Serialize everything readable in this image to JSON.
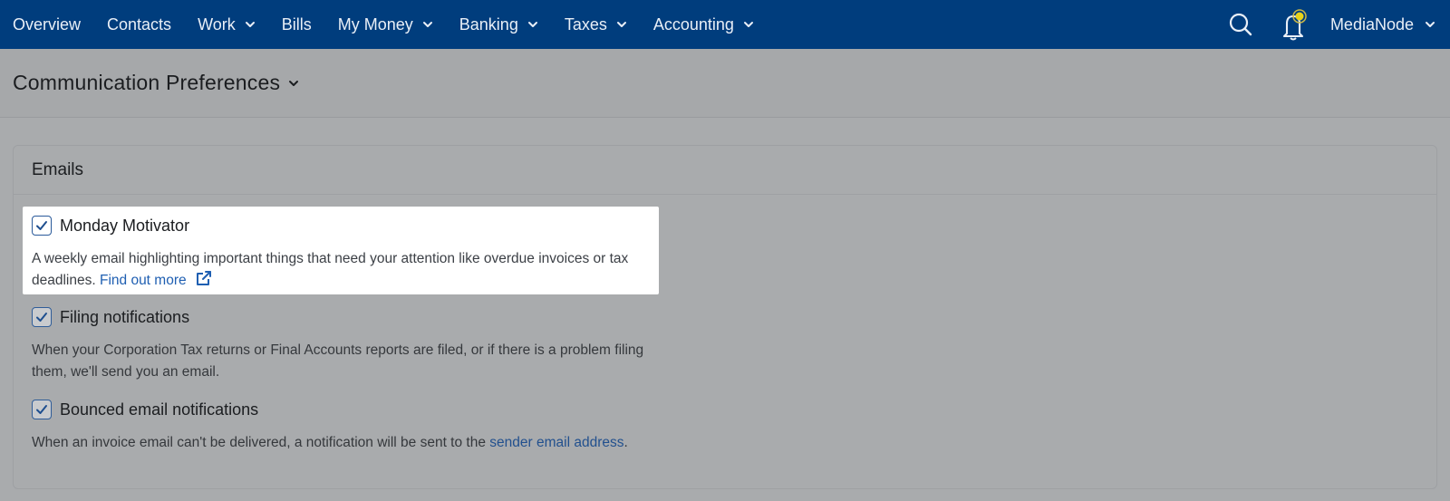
{
  "nav": {
    "items": [
      {
        "label": "Overview",
        "has_dropdown": false
      },
      {
        "label": "Contacts",
        "has_dropdown": false
      },
      {
        "label": "Work",
        "has_dropdown": true
      },
      {
        "label": "Bills",
        "has_dropdown": false
      },
      {
        "label": "My Money",
        "has_dropdown": true
      },
      {
        "label": "Banking",
        "has_dropdown": true
      },
      {
        "label": "Taxes",
        "has_dropdown": true
      },
      {
        "label": "Accounting",
        "has_dropdown": true
      }
    ],
    "account_name": "MediaNode",
    "icons": {
      "search": "search-icon",
      "notifications": "bell-icon"
    },
    "colors": {
      "bar": "#003d7d",
      "notification_dot": "#e8d31a"
    }
  },
  "page": {
    "title": "Communication Preferences"
  },
  "emails": {
    "heading": "Emails",
    "preferences": [
      {
        "label": "Monday Motivator",
        "checked": true,
        "description": "A weekly email highlighting important things that need your attention like overdue invoices or tax deadlines.",
        "link_text": "Find out more",
        "suffix": ""
      },
      {
        "label": "Filing notifications",
        "checked": true,
        "description": "When your Corporation Tax returns or Final Accounts reports are filed, or if there is a problem filing them, we'll send you an email.",
        "link_text": "",
        "suffix": ""
      },
      {
        "label": "Bounced email notifications",
        "checked": true,
        "description": "When an invoice email can't be delivered, a notification will be sent to the",
        "link_text": "sender email address",
        "suffix": "."
      }
    ]
  },
  "colors": {
    "link": "#1f5fb2",
    "checkbox_border": "#2a5a9a",
    "overlay": "#a9abad"
  }
}
